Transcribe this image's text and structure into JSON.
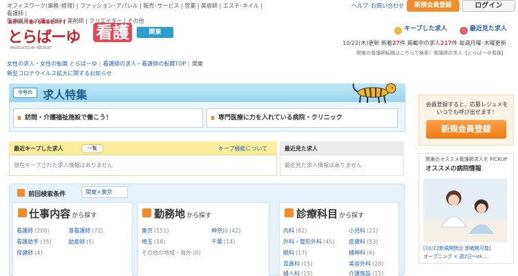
{
  "header": {
    "categories_line1": "オフィスワーク(事務･経理) | ファッション･アパレル | 販売･サービス | 営業 | 美容師 | エステ･ネイル | 看護師 |",
    "categories_line2": "医療事務 | 介護 | 歯科 | 薬剤師 | クリエイター | その他",
    "help_link": "ヘルプ･お問い合わせ",
    "register_button": "新規会員登録",
    "login_button": "ログイン",
    "logo_tagline": "自分らしく働ける職場をさがす",
    "logo_text": "とらばーゆ",
    "logo_nurse": "看護",
    "logo_by": "PRODUCED BY RECRUIT",
    "region_button": "関東",
    "kept_jobs_link": "キープした求人",
    "recent_jobs_link": "最近見た求人",
    "stats": {
      "date": "10/22(木)更新",
      "new_label": "新着",
      "new_count": "27",
      "open_label": "件 掲載中の求人",
      "open_count": "217",
      "tail": "件 毎週月曜･木曜更新"
    },
    "desc": "関東の看護師転職はこちらで検索！看護師の求人【とらばーゆ看護】"
  },
  "breadcrumb": {
    "home": "女性の求人・女性の転職 とらばーゆ",
    "nurse_top": "看護師の求人・看護師の転職TOP",
    "current": "関東"
  },
  "notice": "新型コロナウイルス拡大に関するお知らせ",
  "feature": {
    "badge": "今号の",
    "title": "求人特集",
    "btn1": "訪問・介護福祉施設で働こう！",
    "btn2": "専門医療に力を入れている病院・クリニック"
  },
  "kept": {
    "title": "最近キープした求人",
    "list_button": "一覧",
    "feature_link": "キープ機能について",
    "empty": "現在キープされた求人情報はありません"
  },
  "recent": {
    "title": "最近見た求人",
    "empty": "最近見た求人情報はありません"
  },
  "search": {
    "prev_label": "前回検索条件",
    "prev_value": "関東×東京",
    "columns": [
      {
        "title": "仕事内容",
        "suffix": "から探す",
        "items": [
          {
            "label": "看護師",
            "count": "(200)"
          },
          {
            "label": "准看護師",
            "count": "(72)"
          },
          {
            "label": "看護助手",
            "count": "(35)"
          },
          {
            "label": "助産師",
            "count": "(5)"
          },
          {
            "label": "保健師",
            "count": "(4)"
          }
        ]
      },
      {
        "title": "勤務地",
        "suffix": "から探す",
        "items": [
          {
            "label": "東京",
            "count": "(151)"
          },
          {
            "label": "神奈川",
            "count": "(42)"
          },
          {
            "label": "埼玉",
            "count": "(18)"
          },
          {
            "label": "千葉",
            "count": "(14)"
          },
          {
            "label": "その他の地域・海外",
            "count": "(0)"
          }
        ]
      },
      {
        "title": "診療科目",
        "suffix": "から探す",
        "items": [
          {
            "label": "内科",
            "count": "(82)"
          },
          {
            "label": "小児科",
            "count": "(21)"
          },
          {
            "label": "外科・整形外科",
            "count": "(45)"
          },
          {
            "label": "皮膚科",
            "count": "(53)"
          },
          {
            "label": "眼科",
            "count": "(17)"
          },
          {
            "label": "精神科",
            "count": "(6)"
          },
          {
            "label": "耳鼻科",
            "count": "(15)"
          },
          {
            "label": "美容外科",
            "count": "(28)"
          },
          {
            "label": "婦人科",
            "count": "(15)"
          },
          {
            "label": "介護施設",
            "count": "(11)"
          }
        ]
      }
    ]
  },
  "sidebar": {
    "register_text": "会員登録すると、応募レジュメをいつでも呼び出せます！",
    "register_button": "新規会員登録",
    "hospital_caption": "関東のオススメ看護師求人を PICKUP",
    "hospital_title": "オススメの病院情報",
    "news_line1": "[10/22新規開院企 即戦務可能]",
    "news_line2": "オープニング × 週2日〜ok…"
  },
  "colors": {
    "accent_orange": "#f28c28",
    "brand_red": "#c0272d",
    "link_blue": "#2a62b0",
    "feature_blue": "#2c9fcf"
  }
}
